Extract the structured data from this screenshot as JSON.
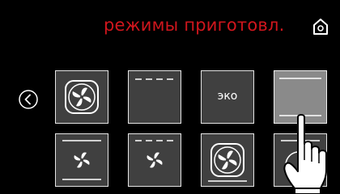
{
  "header": {
    "title": "режимы приготовл."
  },
  "icons": {
    "home": "home-icon",
    "back": "chevron-left-icon",
    "fan": "fan-icon",
    "pointer": "hand-pointer-icon"
  },
  "tiles": [
    {
      "name": "fan",
      "selected": false
    },
    {
      "name": "top-heat-dashed",
      "selected": false
    },
    {
      "name": "eco",
      "label": "эко",
      "selected": false
    },
    {
      "name": "top-bottom-heat",
      "selected": true
    },
    {
      "name": "fan-top-bottom",
      "selected": false
    },
    {
      "name": "fan-top-dashed",
      "selected": false
    },
    {
      "name": "fan-bottom",
      "selected": false
    },
    {
      "name": "fan-grill",
      "selected": false
    }
  ],
  "colors": {
    "title": "#d0161d",
    "background": "#000000",
    "tile": "#404040",
    "tile_selected": "#8a8a8a"
  }
}
